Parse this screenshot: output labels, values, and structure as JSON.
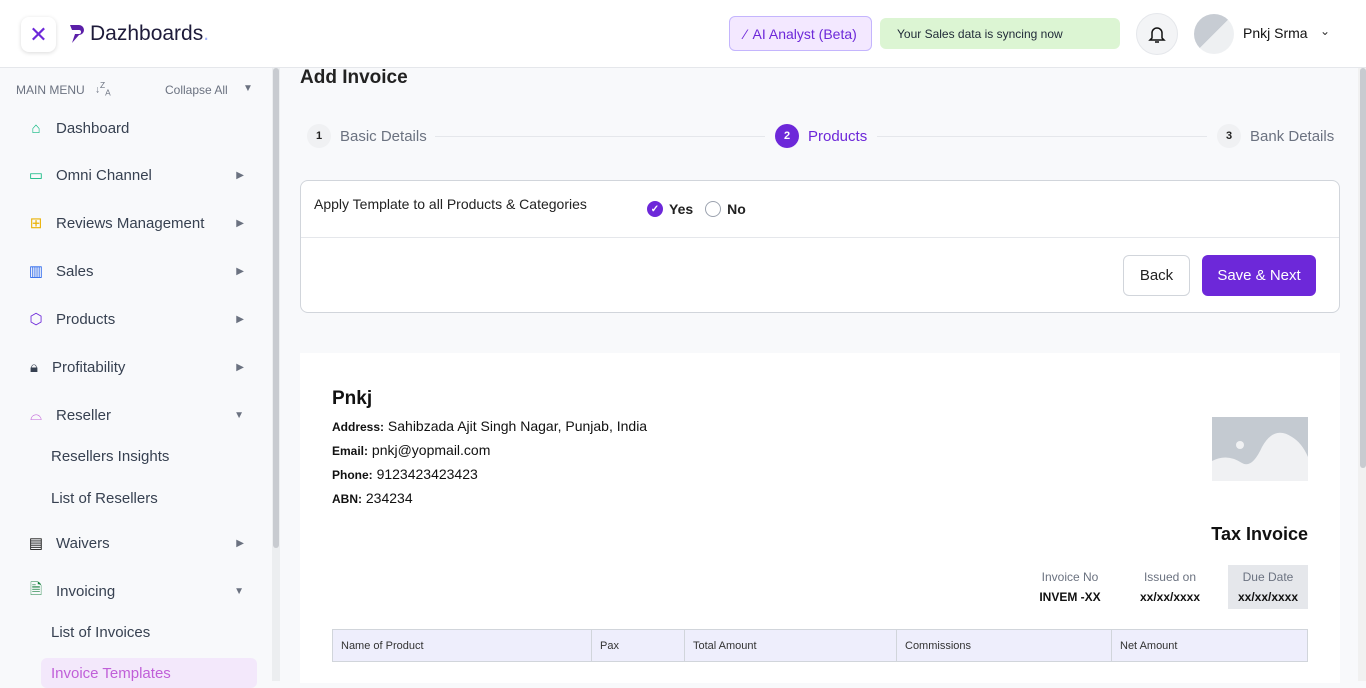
{
  "header": {
    "brand": "Dazhboards",
    "brand_dot": ".",
    "ai_label": "AI Analyst (Beta)",
    "sync_text": "Your Sales data is syncing now",
    "user_name": "Pnkj Srma"
  },
  "sidebar": {
    "menu_label": "MAIN MENU",
    "collapse_label": "Collapse All",
    "items": [
      {
        "label": "Dashboard"
      },
      {
        "label": "Omni Channel"
      },
      {
        "label": "Reviews Management"
      },
      {
        "label": "Sales"
      },
      {
        "label": "Products"
      },
      {
        "label": "Profitability"
      },
      {
        "label": "Reseller"
      },
      {
        "label": "Waivers"
      },
      {
        "label": "Invoicing"
      }
    ],
    "reseller_sub": [
      "Resellers Insights",
      "List of Resellers"
    ],
    "invoicing_sub": [
      "List of Invoices",
      "Invoice Templates"
    ]
  },
  "page": {
    "title": "Add Invoice",
    "steps": [
      {
        "num": "1",
        "label": "Basic Details"
      },
      {
        "num": "2",
        "label": "Products"
      },
      {
        "num": "3",
        "label": "Bank Details"
      }
    ],
    "template_label": "Apply Template to all Products & Categories",
    "yes": "Yes",
    "no": "No",
    "selected": "Yes",
    "back": "Back",
    "save_next": "Save & Next"
  },
  "invoice": {
    "company": "Pnkj",
    "address_label": "Address:",
    "address": "Sahibzada Ajit Singh Nagar, Punjab, India",
    "email_label": "Email:",
    "email": "pnkj@yopmail.com",
    "phone_label": "Phone:",
    "phone": "9123423423423",
    "abn_label": "ABN:",
    "abn": "234234",
    "tax_title": "Tax Invoice",
    "meta": [
      {
        "k": "Invoice No",
        "v": "INVEM -XX"
      },
      {
        "k": "Issued on",
        "v": "xx/xx/xxxx"
      },
      {
        "k": "Due Date",
        "v": "xx/xx/xxxx"
      }
    ],
    "columns": [
      "Name of Product",
      "Pax",
      "Total Amount",
      "Commissions",
      "Net Amount"
    ]
  },
  "colors": {
    "accent": "#6d28d9",
    "sync_bg": "#dcf5d3",
    "table_header": "#eeeefc"
  }
}
